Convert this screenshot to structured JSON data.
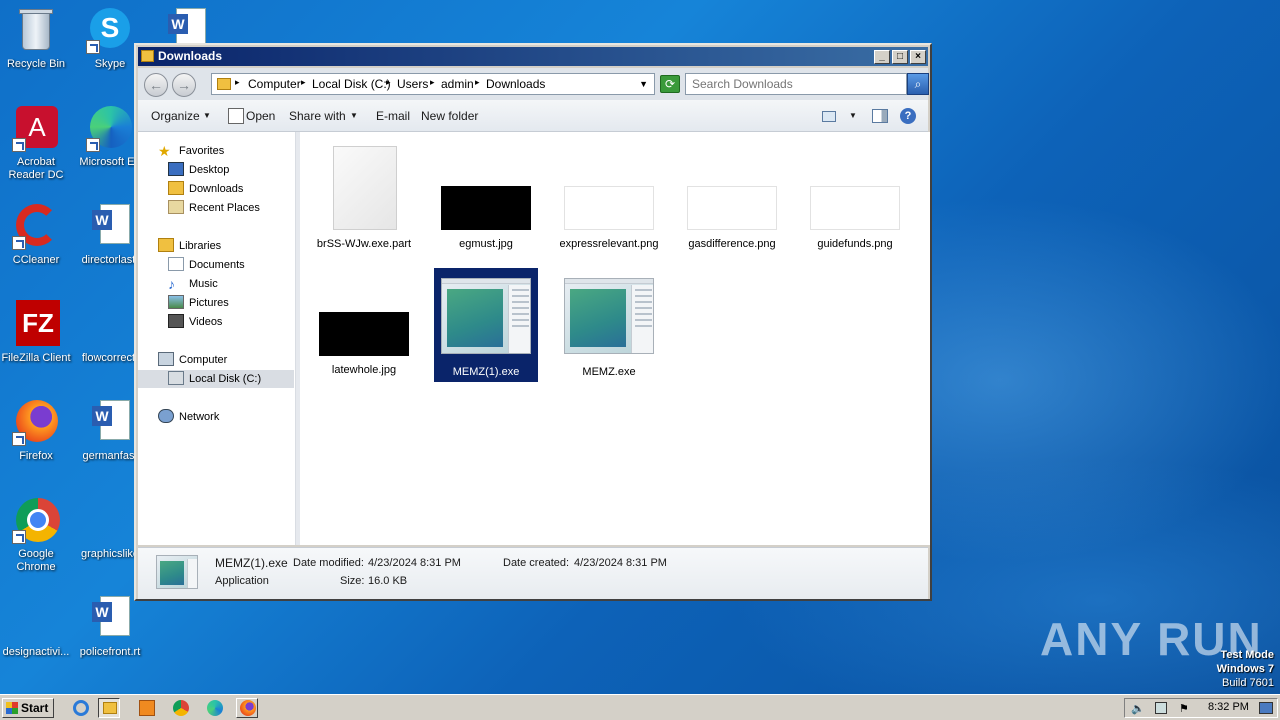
{
  "desktop": {
    "icons": [
      {
        "label": "Recycle Bin"
      },
      {
        "label": "Skype"
      },
      {
        "label": "Acrobat Reader DC"
      },
      {
        "label": "Microsoft Ed"
      },
      {
        "label": "CCleaner"
      },
      {
        "label": "directorlast."
      },
      {
        "label": "FileZilla Client"
      },
      {
        "label": "flowcorrect."
      },
      {
        "label": "Firefox"
      },
      {
        "label": "germanfast"
      },
      {
        "label": "Google Chrome"
      },
      {
        "label": "graphicslike"
      },
      {
        "label": "designactivi..."
      },
      {
        "label": "policefront.rt"
      }
    ]
  },
  "window": {
    "title": "Downloads",
    "address": {
      "crumbs": [
        "Computer",
        "Local Disk (C:)",
        "Users",
        "admin",
        "Downloads"
      ]
    },
    "search": {
      "placeholder": "Search Downloads"
    },
    "toolbar": {
      "organize": "Organize",
      "open": "Open",
      "share_with": "Share with",
      "email": "E-mail",
      "new_folder": "New folder"
    },
    "nav": {
      "favorites": "Favorites",
      "desktop": "Desktop",
      "downloads": "Downloads",
      "recent": "Recent Places",
      "libraries": "Libraries",
      "documents": "Documents",
      "music": "Music",
      "pictures": "Pictures",
      "videos": "Videos",
      "computer": "Computer",
      "local_disk": "Local Disk (C:)",
      "network": "Network"
    },
    "files": [
      {
        "name": "brSS-WJw.exe.part",
        "kind": "blank"
      },
      {
        "name": "egmust.jpg",
        "kind": "black"
      },
      {
        "name": "expressrelevant.png",
        "kind": "white"
      },
      {
        "name": "gasdifference.png",
        "kind": "white"
      },
      {
        "name": "guidefunds.png",
        "kind": "white"
      },
      {
        "name": "latewhole.jpg",
        "kind": "black"
      },
      {
        "name": "MEMZ(1).exe",
        "kind": "app",
        "selected": true
      },
      {
        "name": "MEMZ.exe",
        "kind": "app"
      }
    ],
    "details": {
      "name": "MEMZ(1).exe",
      "type": "Application",
      "modified_label": "Date modified:",
      "modified_value": "4/23/2024 8:31 PM",
      "created_label": "Date created:",
      "created_value": "4/23/2024 8:31 PM",
      "size_label": "Size:",
      "size_value": "16.0 KB"
    }
  },
  "taskbar": {
    "start": "Start",
    "clock": "8:32 PM"
  },
  "watermark": {
    "brand": "ANY RUN",
    "line1": "Test Mode",
    "line2": "Windows 7",
    "line3": "Build 7601"
  }
}
